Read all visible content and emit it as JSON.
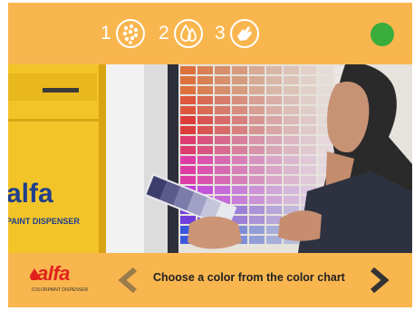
{
  "header": {
    "steps": [
      {
        "number": "1",
        "icon": "palette-dots-icon"
      },
      {
        "number": "2",
        "icon": "drops-icon"
      },
      {
        "number": "3",
        "icon": "hand-icon"
      }
    ],
    "status_color": "#3aad3c"
  },
  "scene": {
    "machine_brand": "alfa",
    "machine_label": "PAINT DISPENSER"
  },
  "footer": {
    "logo_text": "alfa",
    "logo_subtitle": "COLORPAINT DISPENSER",
    "instruction": "Choose a color from the color chart",
    "prev_icon": "chevron-left-icon",
    "next_icon": "chevron-right-icon"
  },
  "colors": {
    "bar_orange": "#f9b64f",
    "status_green": "#3aad3c",
    "prev_arrow": "#9a7b4a",
    "next_arrow": "#333333"
  }
}
